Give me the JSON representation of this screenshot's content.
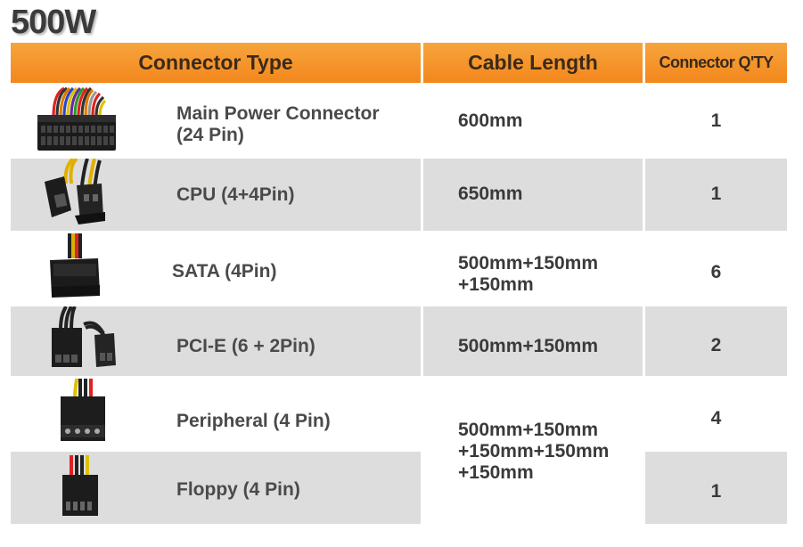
{
  "title": "500W",
  "headers": {
    "connector_type": "Connector Type",
    "cable_length": "Cable Length",
    "qty": "Connector Q'TY"
  },
  "rows": [
    {
      "connector_label": "Main Power Connector\n(24 Pin)",
      "icon": "main-power-connector-icon",
      "cable_length": "600mm",
      "qty": "1"
    },
    {
      "connector_label": "CPU (4+4Pin)",
      "icon": "cpu-connector-icon",
      "cable_length": "650mm",
      "qty": "1"
    },
    {
      "connector_label": "SATA (4Pin)",
      "icon": "sata-connector-icon",
      "cable_length": "500mm+150mm\n+150mm",
      "qty": "6"
    },
    {
      "connector_label": "PCI-E (6 + 2Pin)",
      "icon": "pcie-connector-icon",
      "cable_length": "500mm+150mm",
      "qty": "2"
    },
    {
      "connector_label": "Peripheral (4 Pin)",
      "icon": "peripheral-connector-icon",
      "cable_length": "500mm+150mm\n+150mm+150mm\n+150mm",
      "qty": "4"
    },
    {
      "connector_label": "Floppy (4 Pin)",
      "icon": "floppy-connector-icon",
      "cable_length": "",
      "qty": "1"
    }
  ]
}
